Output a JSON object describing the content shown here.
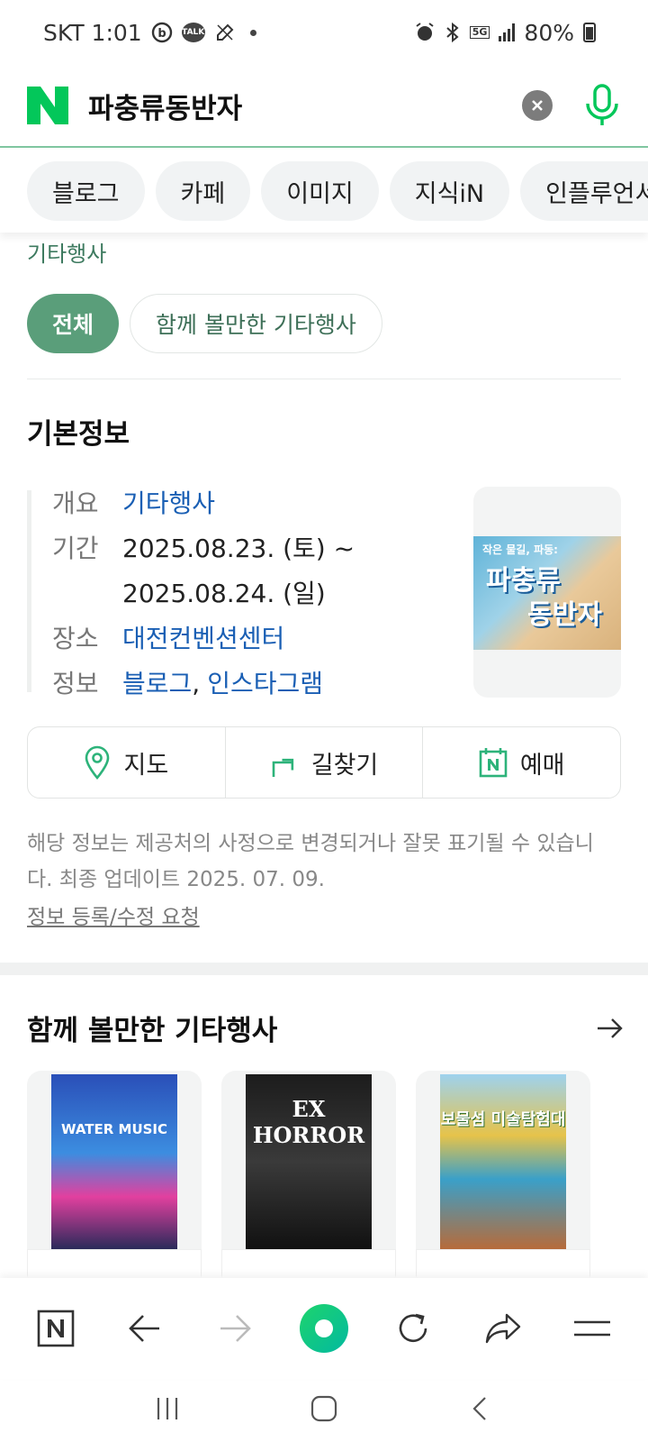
{
  "status_bar": {
    "carrier_time": "SKT 1:01",
    "talk_badge": "TALK",
    "network": "5G",
    "battery": "80%"
  },
  "search": {
    "logo": "N",
    "query": "파충류동반자"
  },
  "tabs": [
    {
      "label": "블로그"
    },
    {
      "label": "카페"
    },
    {
      "label": "이미지"
    },
    {
      "label": "지식iN"
    },
    {
      "label": "인플루언서"
    }
  ],
  "category_label": "기타행사",
  "filters": [
    {
      "label": "전체",
      "active": true
    },
    {
      "label": "함께 볼만한 기타행사",
      "active": false
    }
  ],
  "basic_info": {
    "title": "기본정보",
    "rows": {
      "overview_key": "개요",
      "overview_val": "기타행사",
      "period_key": "기간",
      "period_line1": "2025.08.23. (토) ~",
      "period_line2": "2025.08.24. (일)",
      "place_key": "장소",
      "place_val": "대전컨벤션센터",
      "info_key": "정보",
      "info_blog": "블로그",
      "info_sep": ",",
      "info_insta": "인스타그램"
    },
    "poster": {
      "subtitle": "작은 물길, 파동:",
      "title_line1": "파충류",
      "title_line2": "동반자"
    }
  },
  "actions": {
    "map": "지도",
    "directions": "길찾기",
    "booking": "예매"
  },
  "notice": "해당 정보는 제공처의 사정으로 변경되거나 잘못 표기될 수 있습니다. 최종 업데이트 2025. 07. 09.",
  "report_link": "정보 등록/수정 요청",
  "related": {
    "title": "함께 볼만한 기타행사",
    "cards": [
      {
        "poster_text": "WATER MUSIC"
      },
      {
        "poster_text": "EX HORROR"
      },
      {
        "poster_text": "보물섬 미술탐험대"
      }
    ]
  },
  "colors": {
    "naver_green": "#03c75a",
    "link_blue": "#1a5fb4",
    "active_chip": "#5a9e7a"
  }
}
